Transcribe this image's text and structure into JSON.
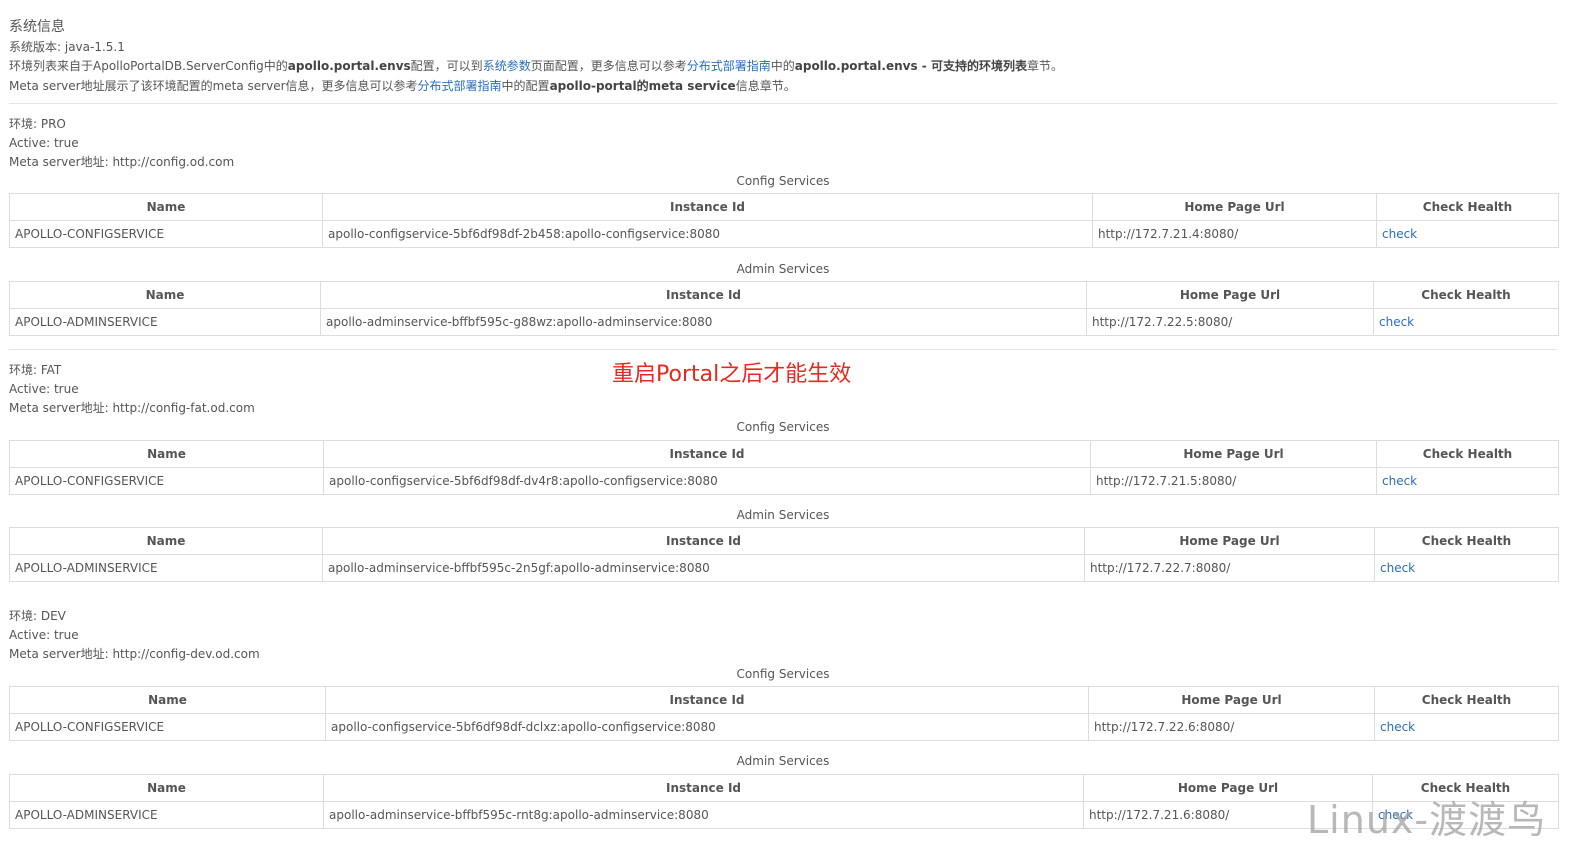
{
  "system": {
    "title": "系统信息",
    "version_label": "系统版本: ",
    "version_value": "java-1.5.1",
    "line2": {
      "t1": "环境列表来自于ApolloPortalDB.ServerConfig中的",
      "b1": "apollo.portal.envs",
      "t2": "配置，可以到",
      "link1": "系统参数",
      "t3": "页面配置，更多信息可以参考",
      "link2": "分布式部署指南",
      "t4": "中的",
      "b2": "apollo.portal.envs - 可支持的环境列表",
      "t5": "章节。"
    },
    "line3": {
      "t1": "Meta server地址展示了该环境配置的meta server信息，更多信息可以参考",
      "link1": "分布式部署指南",
      "t2": "中的配置",
      "b1": "apollo-portal的meta service",
      "t3": "信息章节。"
    }
  },
  "table_headers": {
    "name": "Name",
    "instance_id": "Instance Id",
    "home_page_url": "Home Page Url",
    "check_health": "Check Health"
  },
  "config_caption": "Config Services",
  "admin_caption": "Admin Services",
  "environments": [
    {
      "env": "环境: PRO",
      "active": "Active: true",
      "meta": "Meta server地址: http://config.od.com",
      "config": {
        "name": "APOLLO-CONFIGSERVICE",
        "instance": "apollo-configservice-5bf6df98df-2b458:apollo-configservice:8080",
        "url": "http://172.7.21.4:8080/",
        "check": "check"
      },
      "admin": {
        "name": "APOLLO-ADMINSERVICE",
        "instance": "apollo-adminservice-bffbf595c-g88wz:apollo-adminservice:8080",
        "url": "http://172.7.22.5:8080/",
        "check": "check"
      }
    },
    {
      "env": "环境: FAT",
      "active": "Active: true",
      "meta": "Meta server地址: http://config-fat.od.com",
      "config": {
        "name": "APOLLO-CONFIGSERVICE",
        "instance": "apollo-configservice-5bf6df98df-dv4r8:apollo-configservice:8080",
        "url": "http://172.7.21.5:8080/",
        "check": "check"
      },
      "admin": {
        "name": "APOLLO-ADMINSERVICE",
        "instance": "apollo-adminservice-bffbf595c-2n5gf:apollo-adminservice:8080",
        "url": "http://172.7.22.7:8080/",
        "check": "check"
      }
    },
    {
      "env": "环境: DEV",
      "active": "Active: true",
      "meta": "Meta server地址: http://config-dev.od.com",
      "config": {
        "name": "APOLLO-CONFIGSERVICE",
        "instance": "apollo-configservice-5bf6df98df-dclxz:apollo-configservice:8080",
        "url": "http://172.7.22.6:8080/",
        "check": "check"
      },
      "admin": {
        "name": "APOLLO-ADMINSERVICE",
        "instance": "apollo-adminservice-bffbf595c-rnt8g:apollo-adminservice:8080",
        "url": "http://172.7.21.6:8080/",
        "check": "check"
      }
    }
  ],
  "annotation": "重启Portal之后才能生效",
  "watermark": "Linux-渡渡鸟",
  "colors": {
    "link": "#2a6ebb",
    "annotation": "#e8281e",
    "border": "#dddddd",
    "text": "#555555"
  }
}
